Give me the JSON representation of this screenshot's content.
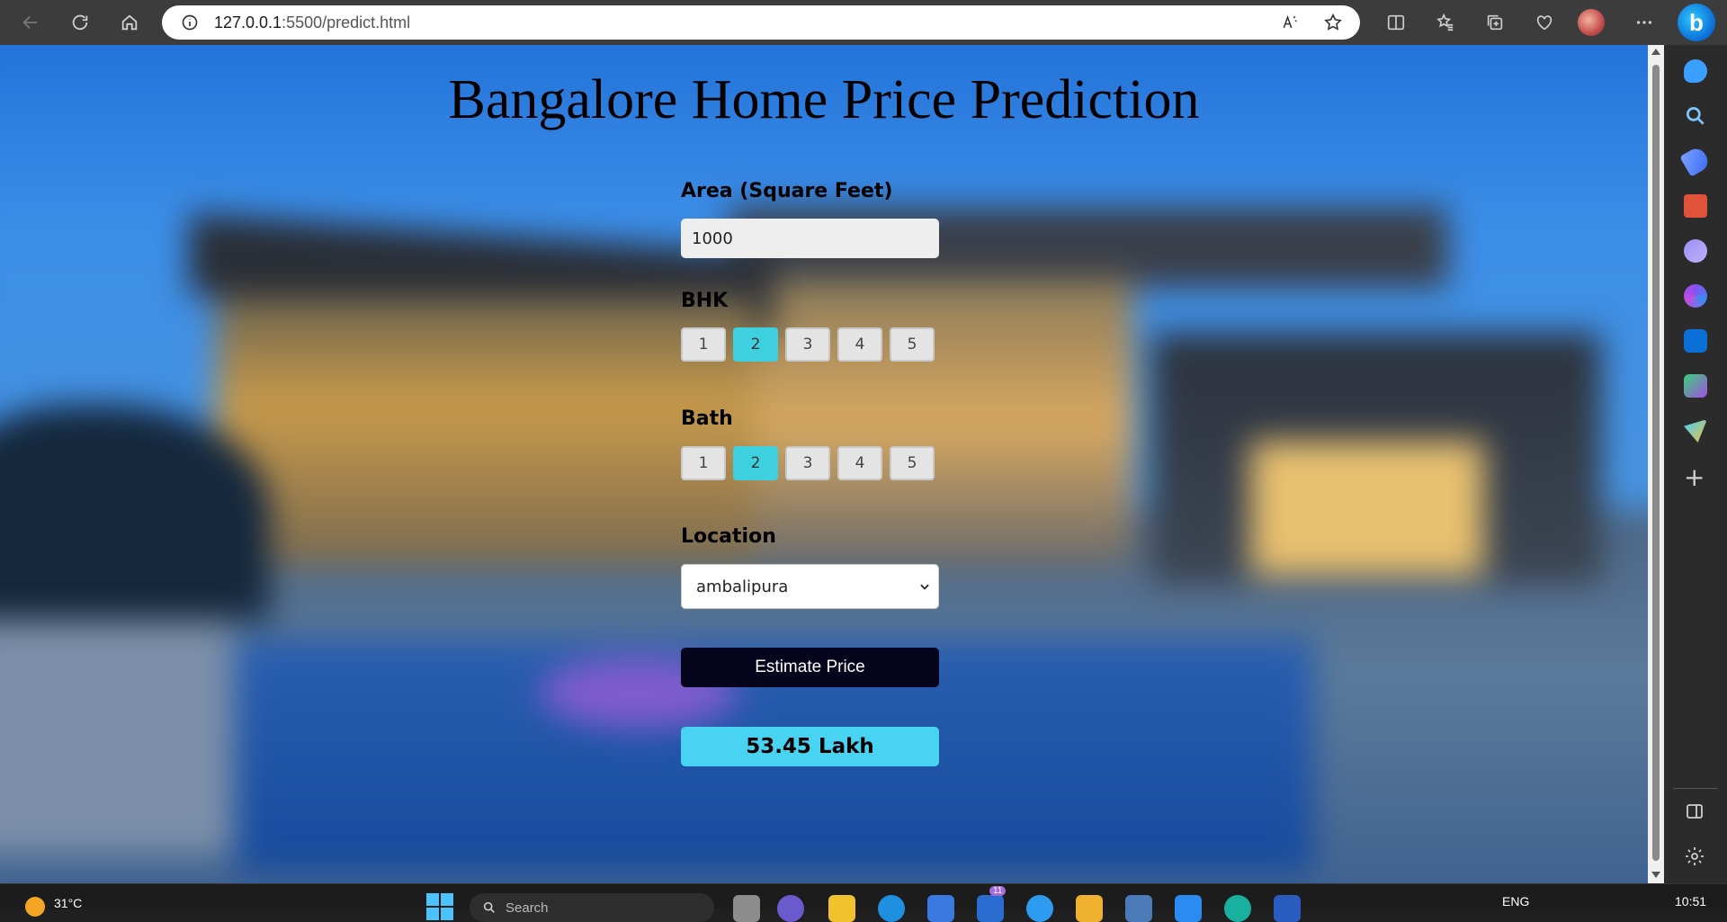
{
  "browser": {
    "url_host": "127.0.0.1",
    "url_path": ":5500/predict.html"
  },
  "page": {
    "title": "Bangalore Home Price Prediction",
    "area_label": "Area (Square Feet)",
    "area_value": "1000",
    "bhk_label": "BHK",
    "bhk_options": [
      "1",
      "2",
      "3",
      "4",
      "5"
    ],
    "bhk_selected": "2",
    "bath_label": "Bath",
    "bath_options": [
      "1",
      "2",
      "3",
      "4",
      "5"
    ],
    "bath_selected": "2",
    "location_label": "Location",
    "location_value": "ambalipura",
    "estimate_label": "Estimate Price",
    "result": "53.45 Lakh"
  },
  "colors": {
    "selected_option": "#3fd0df",
    "estimate_button": "#05061e",
    "result_bg": "#48d3f2"
  },
  "taskbar": {
    "temperature": "31°C",
    "search_placeholder": "Search",
    "badge_count": "11",
    "language": "ENG",
    "time": "10:51"
  }
}
